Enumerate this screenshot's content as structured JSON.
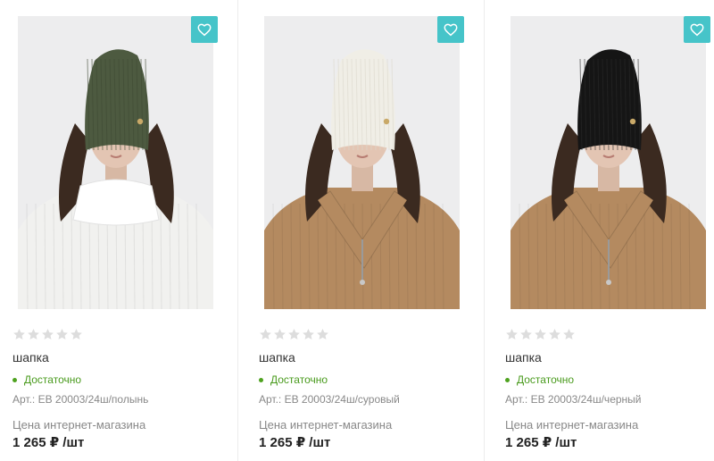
{
  "products": [
    {
      "name": "шапка",
      "rating_stars": 5,
      "rating_value": 0,
      "availability": "Достаточно",
      "article": "Арт.: ЕВ 20003/24ш/полынь",
      "price_label": "Цена интернет-магазина",
      "price": "1 265 ₽ /шт",
      "hat_color": "#4d5a40",
      "outfit_color": "#f1f1ef",
      "favorite_icon": "heart-icon"
    },
    {
      "name": "шапка",
      "rating_stars": 5,
      "rating_value": 0,
      "availability": "Достаточно",
      "article": "Арт.: ЕВ 20003/24ш/суровый",
      "price_label": "Цена интернет-магазина",
      "price": "1 265 ₽ /шт",
      "hat_color": "#f0eee6",
      "outfit_color": "#b48a60",
      "favorite_icon": "heart-icon"
    },
    {
      "name": "шапка",
      "rating_stars": 5,
      "rating_value": 0,
      "availability": "Достаточно",
      "article": "Арт.: ЕВ 20003/24ш/черный",
      "price_label": "Цена интернет-магазина",
      "price": "1 265 ₽ /шт",
      "hat_color": "#151515",
      "outfit_color": "#b48a60",
      "favorite_icon": "heart-icon"
    }
  ],
  "colors": {
    "accent": "#46c4c9",
    "in_stock": "#4a9b1e",
    "star_empty": "#dddddd",
    "photo_bg": "#ededee"
  }
}
